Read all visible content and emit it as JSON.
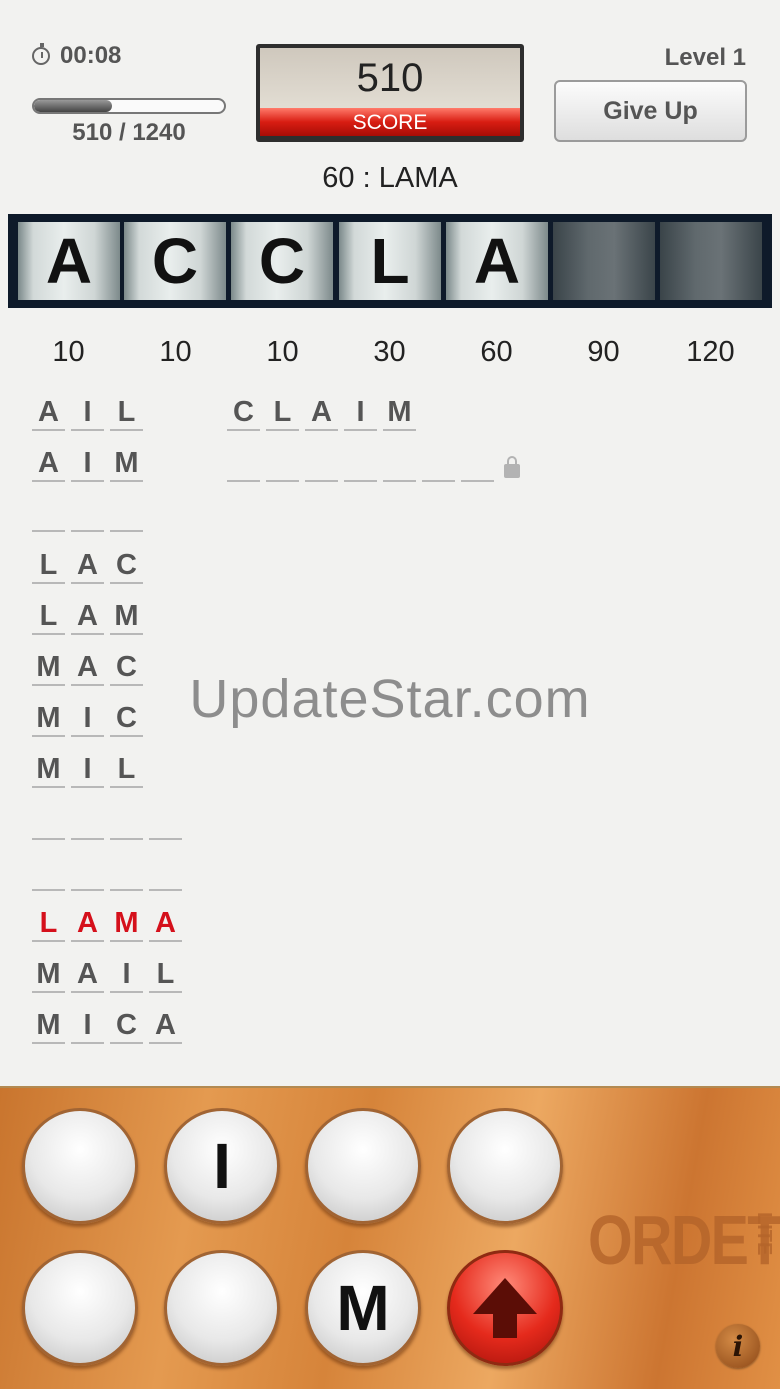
{
  "header": {
    "timer": "00:08",
    "progress_text": "510 / 1240",
    "progress_fraction": 0.41,
    "score_value": "510",
    "score_label": "SCORE",
    "level": "Level 1",
    "give_up": "Give Up",
    "last_word": "60 : LAMA"
  },
  "tiles": [
    "A",
    "C",
    "C",
    "L",
    "A",
    "",
    ""
  ],
  "points": [
    "10",
    "10",
    "10",
    "30",
    "60",
    "90",
    "120"
  ],
  "words": {
    "three_letter": [
      [
        "A",
        "I",
        "L"
      ],
      [
        "A",
        "I",
        "M"
      ],
      [
        "",
        "",
        ""
      ],
      [
        "L",
        "A",
        "C"
      ],
      [
        "L",
        "A",
        "M"
      ],
      [
        "M",
        "A",
        "C"
      ],
      [
        "M",
        "I",
        "C"
      ],
      [
        "M",
        "I",
        "L"
      ]
    ],
    "four_letter": [
      [
        "",
        "",
        "",
        ""
      ],
      [
        "",
        "",
        "",
        ""
      ],
      [
        "L",
        "A",
        "M",
        "A"
      ],
      [
        "M",
        "A",
        "I",
        "L"
      ],
      [
        "M",
        "I",
        "C",
        "A"
      ]
    ],
    "five_letter": [
      [
        "C",
        "L",
        "A",
        "I",
        "M"
      ]
    ],
    "seven_letter_locked": [
      "",
      "",
      "",
      "",
      "",
      "",
      ""
    ]
  },
  "highlight_word_index": 2,
  "highlight_color": "#d5101b",
  "watermark": "UpdateStar.com",
  "keyboard": {
    "keys": [
      "",
      "I",
      "",
      "",
      "",
      "",
      "M"
    ],
    "submit_icon": "up-arrow-icon"
  },
  "brand": {
    "name": "ORDET",
    "suffix": "LITE"
  },
  "info_label": "i"
}
